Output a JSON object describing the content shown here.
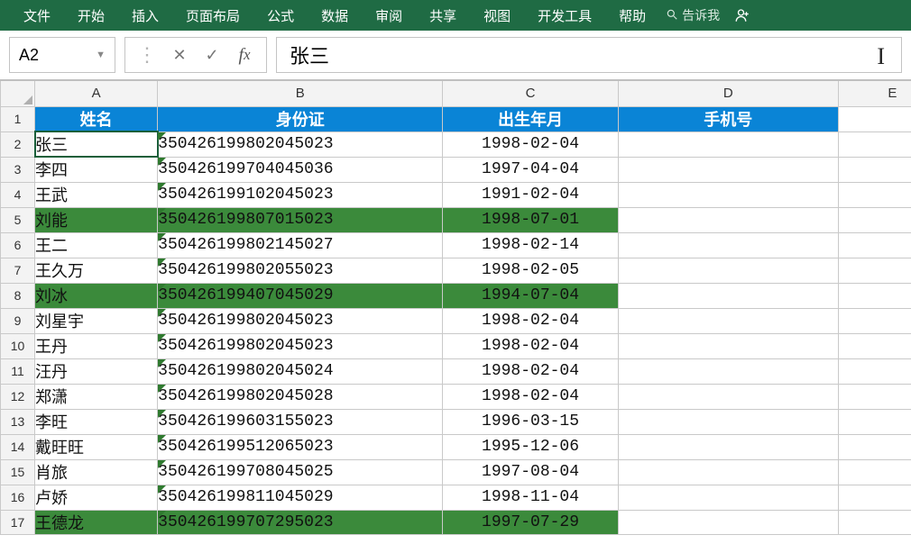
{
  "menu": {
    "items": [
      "文件",
      "开始",
      "插入",
      "页面布局",
      "公式",
      "数据",
      "审阅",
      "共享",
      "视图",
      "开发工具",
      "帮助"
    ],
    "tell_me": "告诉我"
  },
  "formula_bar": {
    "name_box": "A2",
    "formula_value": "张三"
  },
  "columns": [
    "A",
    "B",
    "C",
    "D",
    "E"
  ],
  "header_row": {
    "name": "姓名",
    "id": "身份证",
    "dob": "出生年月",
    "phone": "手机号"
  },
  "rows": [
    {
      "n": 2,
      "name": "张三",
      "id": "350426199802045023",
      "dob": "1998-02-04",
      "hl": false,
      "sel": true
    },
    {
      "n": 3,
      "name": "李四",
      "id": "350426199704045036",
      "dob": "1997-04-04",
      "hl": false
    },
    {
      "n": 4,
      "name": "王武",
      "id": "350426199102045023",
      "dob": "1991-02-04",
      "hl": false
    },
    {
      "n": 5,
      "name": "刘能",
      "id": "350426199807015023",
      "dob": "1998-07-01",
      "hl": true
    },
    {
      "n": 6,
      "name": "王二",
      "id": "350426199802145027",
      "dob": "1998-02-14",
      "hl": false
    },
    {
      "n": 7,
      "name": "王久万",
      "id": "350426199802055023",
      "dob": "1998-02-05",
      "hl": false
    },
    {
      "n": 8,
      "name": "刘冰",
      "id": "350426199407045029",
      "dob": "1994-07-04",
      "hl": true
    },
    {
      "n": 9,
      "name": "刘星宇",
      "id": "350426199802045023",
      "dob": "1998-02-04",
      "hl": false
    },
    {
      "n": 10,
      "name": "王丹",
      "id": "350426199802045023",
      "dob": "1998-02-04",
      "hl": false
    },
    {
      "n": 11,
      "name": "汪丹",
      "id": "350426199802045024",
      "dob": "1998-02-04",
      "hl": false
    },
    {
      "n": 12,
      "name": "郑潇",
      "id": "350426199802045028",
      "dob": "1998-02-04",
      "hl": false
    },
    {
      "n": 13,
      "name": "李旺",
      "id": "350426199603155023",
      "dob": "1996-03-15",
      "hl": false
    },
    {
      "n": 14,
      "name": "戴旺旺",
      "id": "350426199512065023",
      "dob": "1995-12-06",
      "hl": false
    },
    {
      "n": 15,
      "name": "肖旅",
      "id": "350426199708045025",
      "dob": "1997-08-04",
      "hl": false
    },
    {
      "n": 16,
      "name": "卢娇",
      "id": "350426199811045029",
      "dob": "1998-11-04",
      "hl": false
    },
    {
      "n": 17,
      "name": "王德龙",
      "id": "350426199707295023",
      "dob": "1997-07-29",
      "hl": true
    }
  ]
}
